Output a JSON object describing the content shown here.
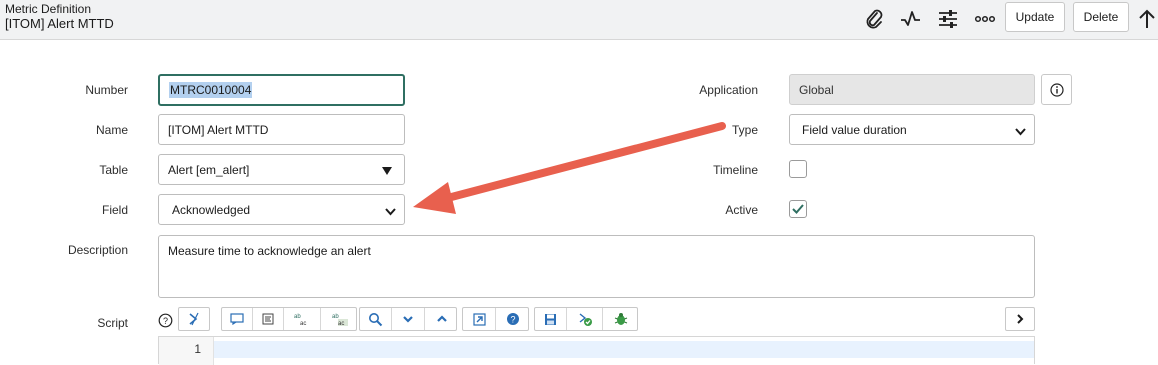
{
  "header": {
    "record_type": "Metric Definition",
    "record_name": "[ITOM] Alert MTTD",
    "update_label": "Update",
    "delete_label": "Delete",
    "icons": [
      "paperclip-icon",
      "activity-icon",
      "settings-sliders-icon",
      "more-options-icon",
      "arrow-up-icon"
    ]
  },
  "form": {
    "number": {
      "label": "Number",
      "value": "MTRC0010004"
    },
    "name": {
      "label": "Name",
      "value": "[ITOM] Alert MTTD"
    },
    "table": {
      "label": "Table",
      "value": "Alert [em_alert]"
    },
    "field": {
      "label": "Field",
      "value": "Acknowledged"
    },
    "description": {
      "label": "Description",
      "value": "Measure time to acknowledge an alert"
    },
    "script": {
      "label": "Script"
    },
    "application": {
      "label": "Application",
      "value": "Global"
    },
    "type": {
      "label": "Type",
      "value": "Field value duration"
    },
    "timeline": {
      "label": "Timeline",
      "checked": false
    },
    "active": {
      "label": "Active",
      "checked": true
    }
  },
  "editor": {
    "line_numbers": [
      "1"
    ]
  },
  "colors": {
    "focus_border": "#2f6f62",
    "annotation_arrow": "#e8604e",
    "check": "#2f6f62"
  }
}
